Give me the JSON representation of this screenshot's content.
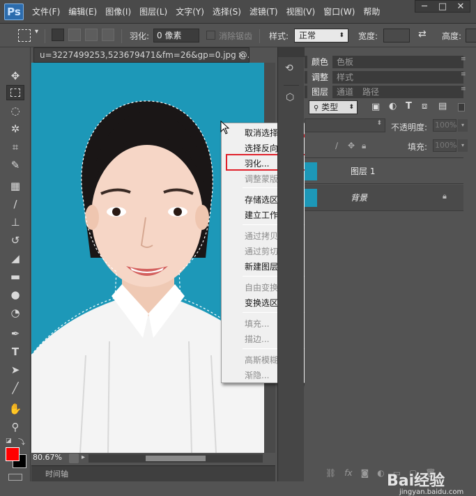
{
  "app": {
    "logo": "Ps"
  },
  "menubar": {
    "items": [
      "文件(F)",
      "编辑(E)",
      "图像(I)",
      "图层(L)",
      "文字(Y)",
      "选择(S)",
      "滤镜(T)",
      "视图(V)",
      "窗口(W)",
      "帮助"
    ],
    "minimize": "─",
    "restore": "□",
    "close": "✕"
  },
  "options": {
    "feather_label": "羽化:",
    "feather_value": "0 像素",
    "antialias_label": "消除锯齿",
    "style_label": "样式:",
    "style_value": "正常",
    "width_label": "宽度:",
    "height_label": "高度:"
  },
  "document": {
    "tab_title": "u=3227499253,523679471&fm=26&gp=0.jpg @...",
    "close": "×",
    "zoom": "80.67%",
    "timeline_label": "时间轴"
  },
  "context_menu": {
    "items": [
      {
        "label": "取消选择",
        "enabled": true
      },
      {
        "label": "选择反向",
        "enabled": true
      },
      {
        "label": "羽化...",
        "enabled": true,
        "highlighted": true
      },
      {
        "label": "调整蒙版...",
        "enabled": false
      },
      {
        "label": "存储选区...",
        "enabled": true
      },
      {
        "label": "建立工作路径...",
        "enabled": true
      },
      {
        "label": "通过拷贝的图层",
        "enabled": false
      },
      {
        "label": "通过剪切的图层",
        "enabled": false
      },
      {
        "label": "新建图层...",
        "enabled": true
      },
      {
        "label": "自由变换",
        "enabled": false
      },
      {
        "label": "变换选区",
        "enabled": true
      },
      {
        "label": "填充...",
        "enabled": false
      },
      {
        "label": "描边...",
        "enabled": false
      },
      {
        "label": "高斯模糊",
        "enabled": false
      },
      {
        "label": "渐隐...",
        "enabled": false
      }
    ]
  },
  "panels": {
    "color_tabs": [
      "颜色",
      "色板"
    ],
    "adjust_tabs": [
      "调整",
      "样式"
    ],
    "layer_tabs": [
      "图层",
      "通道",
      "路径"
    ],
    "kind_filter": "类型",
    "opacity_label": "不透明度:",
    "opacity_value": "100%",
    "fill_label": "填充:",
    "fill_value": "100%",
    "layers": [
      {
        "name": "图层 1"
      },
      {
        "name": "背景",
        "locked": true
      }
    ]
  },
  "watermark": {
    "brand": "Bai经验",
    "url": "jingyan.baidu.com"
  },
  "colors": {
    "foreground": "#ff0000",
    "background": "#000000",
    "canvas_bg": "#1d98b8",
    "highlight": "#e0202a"
  }
}
